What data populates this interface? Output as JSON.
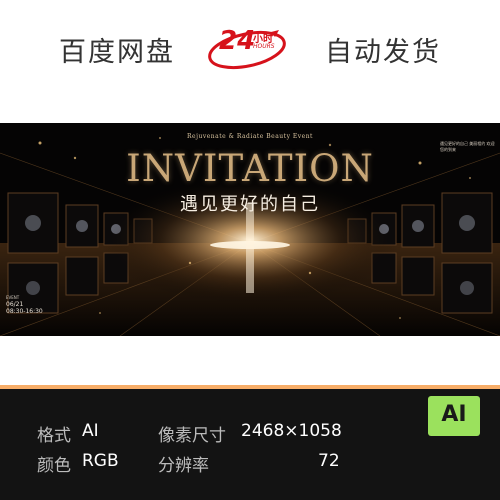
{
  "header": {
    "left_text": "百度网盘",
    "badge_number": "24",
    "badge_cn": "小时",
    "badge_en": "HOURS",
    "right_text": "自动发货",
    "badge_color": "#d6121b"
  },
  "hero": {
    "subtitle": "Rejuvenate & Radiate Beauty Event",
    "title": "INVITATION",
    "cn_title": "遇见更好的自己",
    "date_label": "EVENT",
    "date": "06/21",
    "time": "08:30-16:30",
    "right_note": "遇见更好的自己 美丽相约 欢迎您的到来"
  },
  "specs": {
    "format_label": "格式",
    "format_value": "AI",
    "color_label": "颜色",
    "color_value": "RGB",
    "size_label": "像素尺寸",
    "size_value": "2468×1058",
    "dpi_label": "分辨率",
    "dpi_value": "72"
  },
  "ai_badge": {
    "text": "AI",
    "color": "#9be15d"
  },
  "accent": {
    "gold": "#c9a777",
    "orange": "#f7ad68",
    "dark": "#131313"
  }
}
